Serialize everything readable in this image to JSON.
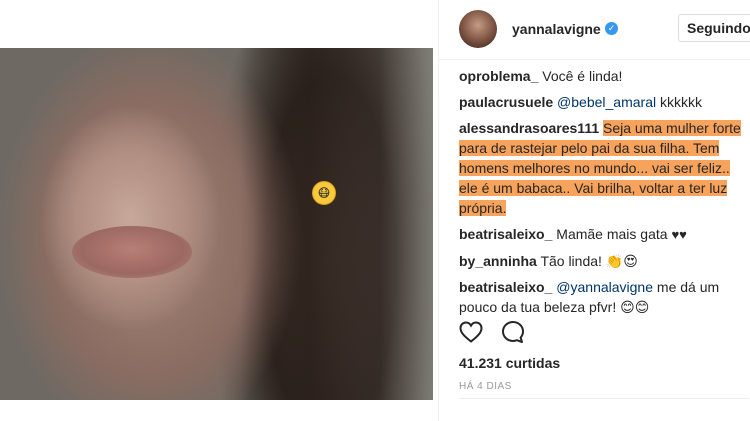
{
  "post": {
    "author": "yannalavigne",
    "follow_label": "Seguindo",
    "likes_text": "41.231 curtidas",
    "timestamp": "HÁ 4 DIAS"
  },
  "comments": [
    {
      "user": "oproblema_",
      "text": "Você é linda!"
    },
    {
      "user": "paulacrusuele",
      "mention": "@bebel_amaral",
      "text": "kkkkkk"
    },
    {
      "user": "alessandrasoares111",
      "text": "Seja uma mulher forte para de rastejar pelo pai da sua filha. Tem homens melhores no mundo... vai ser feliz.. ele é um babaca.. Vai brilha, voltar a ter luz própria."
    },
    {
      "user": "beatrisaleixo_",
      "text": "Mamãe mais gata",
      "emoji": "♥♥"
    },
    {
      "user": "by_anninha",
      "text": "Tão linda!",
      "emoji": "👏😍"
    },
    {
      "user": "beatrisaleixo_",
      "mention": "@yannalavigne",
      "text": "me dá um pouco da tua beleza pfvr!",
      "emoji": "😊😊"
    }
  ],
  "colors": {
    "highlight": "#f7a35c",
    "verified": "#3897f0",
    "mention": "#003569"
  },
  "icons": {
    "verified": "verified-badge-icon",
    "like": "heart-outline-icon",
    "comment": "comment-bubble-icon",
    "sticker": "emoji-sticker-icon"
  }
}
